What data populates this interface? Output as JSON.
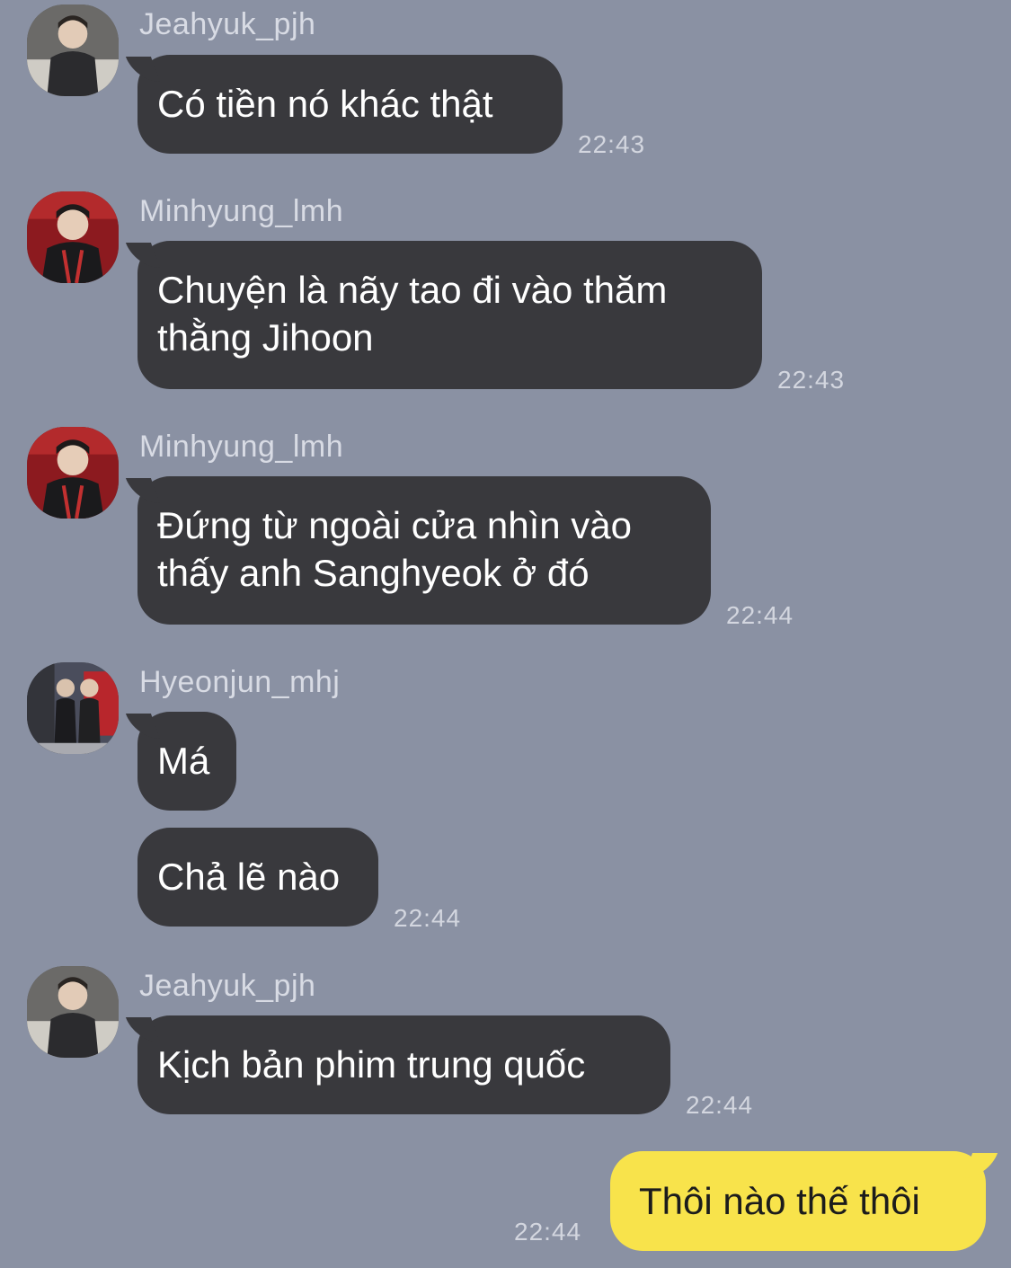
{
  "messages": [
    {
      "sender": "Jeahyuk_pjh",
      "text": "Có tiền nó khác thật",
      "time": "22:43"
    },
    {
      "sender": "Minhyung_lmh",
      "line1": "Chuyện là nãy tao đi vào thăm",
      "line2": "thằng Jihoon",
      "time": "22:43"
    },
    {
      "sender": "Minhyung_lmh",
      "line1": "Đứng từ ngoài cửa nhìn vào",
      "line2": "thấy anh Sanghyeok ở đó",
      "time": "22:44"
    },
    {
      "sender": "Hyeonjun_mhj",
      "text1": "Má",
      "text2": "Chả lẽ nào",
      "time": "22:44"
    },
    {
      "sender": "Jeahyuk_pjh",
      "text": "Kịch bản phim trung quốc",
      "time": "22:44"
    }
  ],
  "outgoing": {
    "text": "Thôi nào thế thôi",
    "time": "22:44"
  },
  "colors": {
    "background": "#8a91a3",
    "incoming_bubble": "#39393d",
    "outgoing_bubble": "#f8e34b"
  }
}
